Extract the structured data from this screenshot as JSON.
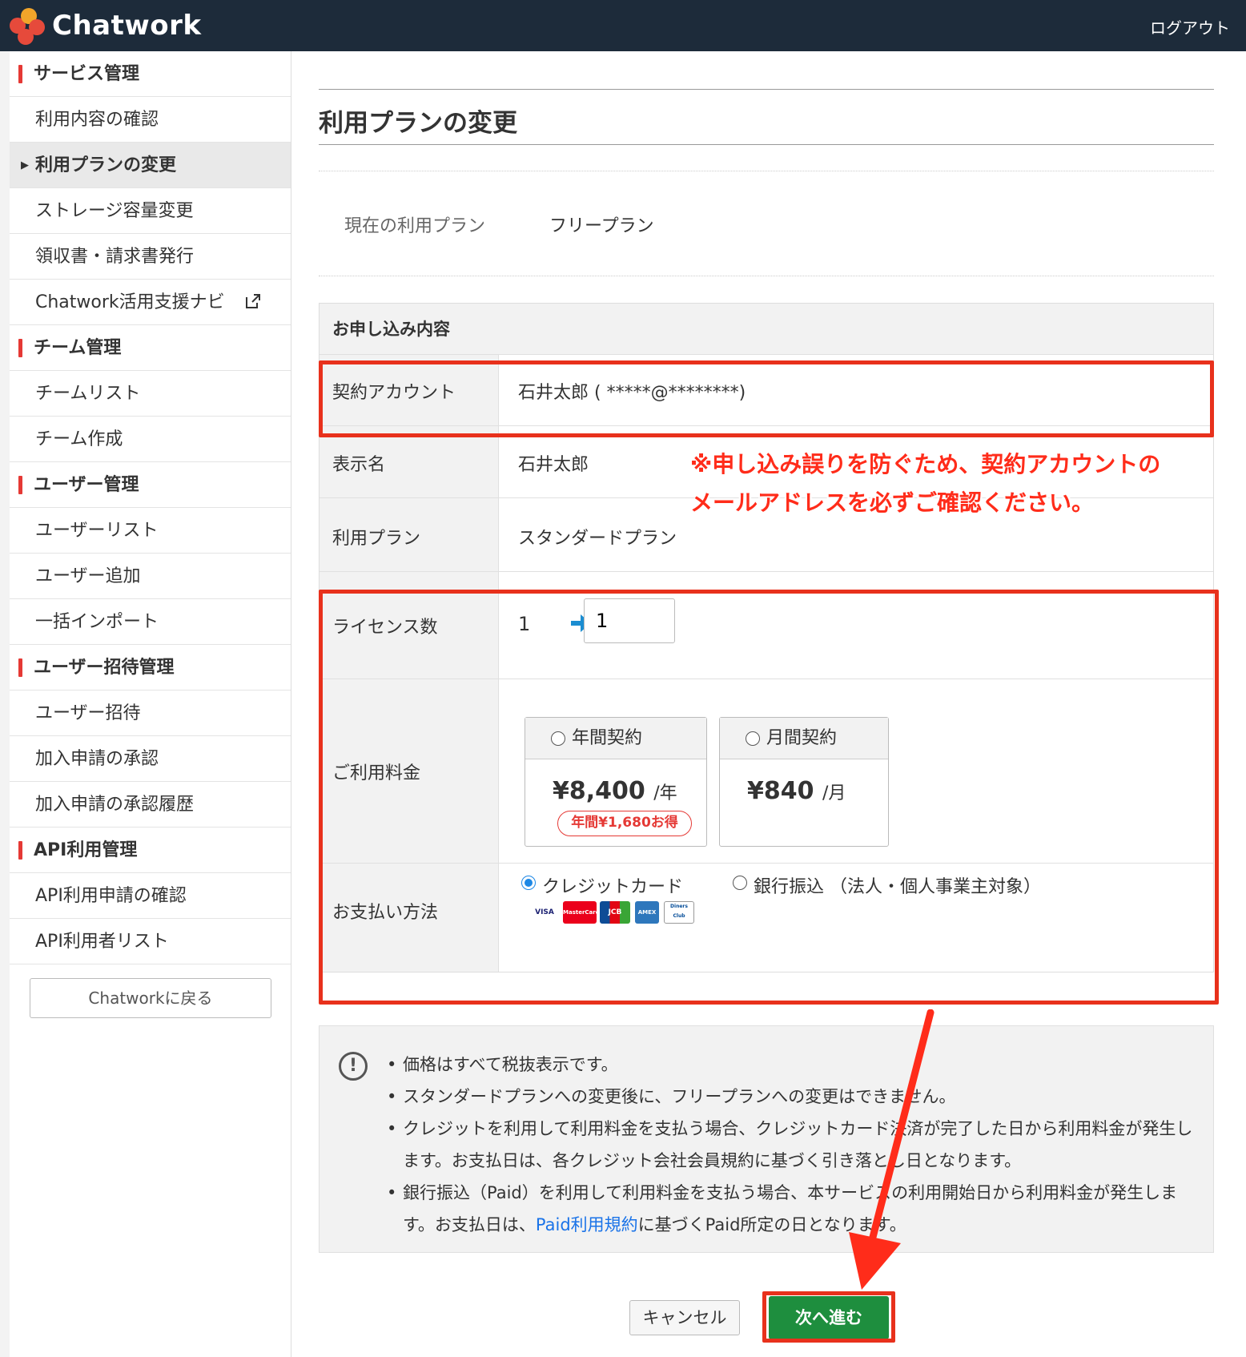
{
  "header": {
    "brand": "Chatwork",
    "logout": "ログアウト"
  },
  "sidebar": {
    "items": [
      {
        "label": "サービス管理",
        "type": "heading"
      },
      {
        "label": "利用内容の確認",
        "type": "link"
      },
      {
        "label": "利用プランの変更",
        "type": "active"
      },
      {
        "label": "ストレージ容量変更",
        "type": "link"
      },
      {
        "label": "領収書・請求書発行",
        "type": "link"
      },
      {
        "label": "Chatwork活用支援ナビ",
        "type": "external"
      },
      {
        "label": "チーム管理",
        "type": "heading"
      },
      {
        "label": "チームリスト",
        "type": "link"
      },
      {
        "label": "チーム作成",
        "type": "link"
      },
      {
        "label": "ユーザー管理",
        "type": "heading"
      },
      {
        "label": "ユーザーリスト",
        "type": "link"
      },
      {
        "label": "ユーザー追加",
        "type": "link"
      },
      {
        "label": "一括インポート",
        "type": "link"
      },
      {
        "label": "ユーザー招待管理",
        "type": "heading"
      },
      {
        "label": "ユーザー招待",
        "type": "link"
      },
      {
        "label": "加入申請の承認",
        "type": "link"
      },
      {
        "label": "加入申請の承認履歴",
        "type": "link"
      },
      {
        "label": "API利用管理",
        "type": "heading"
      },
      {
        "label": "API利用申請の確認",
        "type": "link"
      },
      {
        "label": "API利用者リスト",
        "type": "link"
      }
    ],
    "back_button": "Chatworkに戻る"
  },
  "main": {
    "title": "利用プランの変更",
    "current_plan_label": "現在の利用プラン",
    "current_plan_value": "フリープラン",
    "application": {
      "heading": "お申し込み内容",
      "account_label": "契約アカウント",
      "account_value": "石井太郎 ( *****@********)",
      "display_name_label": "表示名",
      "display_name_value": "石井太郎",
      "plan_label": "利用プラン",
      "plan_value": "スタンダードプラン",
      "license_label": "ライセンス数",
      "license_current": "1",
      "license_input": "1",
      "fee_label": "ご利用料金",
      "annual": {
        "label": "年間契約",
        "price": "¥8,400",
        "unit": "/年",
        "badge": "年間¥1,680お得"
      },
      "monthly": {
        "label": "月間契約",
        "price": "¥840",
        "unit": "/月"
      },
      "payment_label": "お支払い方法",
      "payment_credit": "クレジットカード",
      "payment_bank": "銀行振込 （法人・個人事業主対象）",
      "card_brands": [
        "VISA",
        "MasterCard",
        "JCB",
        "AMEX",
        "Diners Club"
      ]
    },
    "notes": {
      "n1": "価格はすべて税抜表示です。",
      "n2": "スタンダードプランへの変更後に、フリープランへの変更はできません。",
      "n3": "クレジットを利用して利用料金を支払う場合、クレジットカード決済が完了した日から利用料金が発生します。お支払日は、各クレジット会社会員規約に基づく引き落とし日となります。",
      "n4_before": "銀行振込（Paid）を利用して利用料金を支払う場合、本サービスの利用開始日から利用料金が発生します。お支払日は、",
      "n4_link": "Paid利用規約",
      "n4_after": "に基づくPaid所定の日となります。"
    },
    "cancel_button": "キャンセル",
    "next_button": "次へ進む"
  },
  "annotation": {
    "line1": "※申し込み誤りを防ぐため、契約アカウントの",
    "line2": "メールアドレスを必ずご確認ください。",
    "color": "#e8311c"
  }
}
